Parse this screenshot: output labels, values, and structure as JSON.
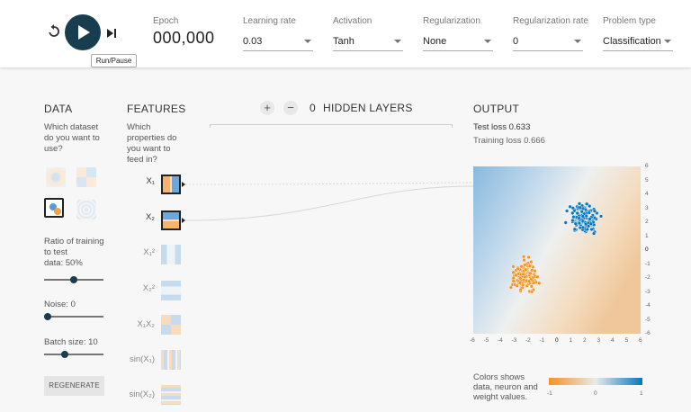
{
  "topbar": {
    "tooltip": "Run/Pause",
    "epoch": {
      "label": "Epoch",
      "value": "000,000"
    },
    "learning_rate": {
      "label": "Learning rate",
      "value": "0.03"
    },
    "activation": {
      "label": "Activation",
      "value": "Tanh"
    },
    "regularization": {
      "label": "Regularization",
      "value": "None"
    },
    "regularization_rate": {
      "label": "Regularization rate",
      "value": "0"
    },
    "problem_type": {
      "label": "Problem type",
      "value": "Classification"
    }
  },
  "data_panel": {
    "title": "DATA",
    "question": [
      "Which dataset",
      "do you want to",
      "use?"
    ],
    "ratio_label": [
      "Ratio of training",
      "to test"
    ],
    "ratio_value": "data:  50%",
    "ratio_fraction": 0.5,
    "noise_label": "Noise:  0",
    "noise_fraction": 0.0,
    "batch_label": "Batch size:  10",
    "batch_fraction": 0.32,
    "regenerate": "REGENERATE"
  },
  "features_panel": {
    "title": "FEATURES",
    "question": [
      "Which",
      "properties do",
      "you want to",
      "feed in?"
    ],
    "features": [
      {
        "label": "X₁",
        "active": true
      },
      {
        "label": "X₂",
        "active": true
      },
      {
        "label": "X₁²",
        "active": false
      },
      {
        "label": "X₂²",
        "active": false
      },
      {
        "label": "X₁X₂",
        "active": false
      },
      {
        "label": "sin(X₁)",
        "active": false
      },
      {
        "label": "sin(X₂)",
        "active": false
      }
    ]
  },
  "hidden": {
    "count": "0",
    "label": "HIDDEN LAYERS",
    "plus": "+",
    "minus": "−"
  },
  "output": {
    "title": "OUTPUT",
    "test_loss": "Test loss 0.633",
    "training_loss": "Training loss 0.666",
    "x_ticks": [
      "-6",
      "-5",
      "-4",
      "-3",
      "-2",
      "-1",
      "0",
      "1",
      "2",
      "3",
      "4",
      "5",
      "6"
    ],
    "y_ticks": [
      "6",
      "5",
      "4",
      "3",
      "2",
      "1",
      "0",
      "-1",
      "-2",
      "-3",
      "-4",
      "-5",
      "-6"
    ],
    "legend_text": [
      "Colors shows",
      "data, neuron and",
      "weight values."
    ],
    "legend_ticks": [
      "-1",
      "0",
      "1"
    ]
  },
  "colors": {
    "positive": "#0877bd",
    "negative": "#f59322",
    "dark": "#183d4e"
  }
}
